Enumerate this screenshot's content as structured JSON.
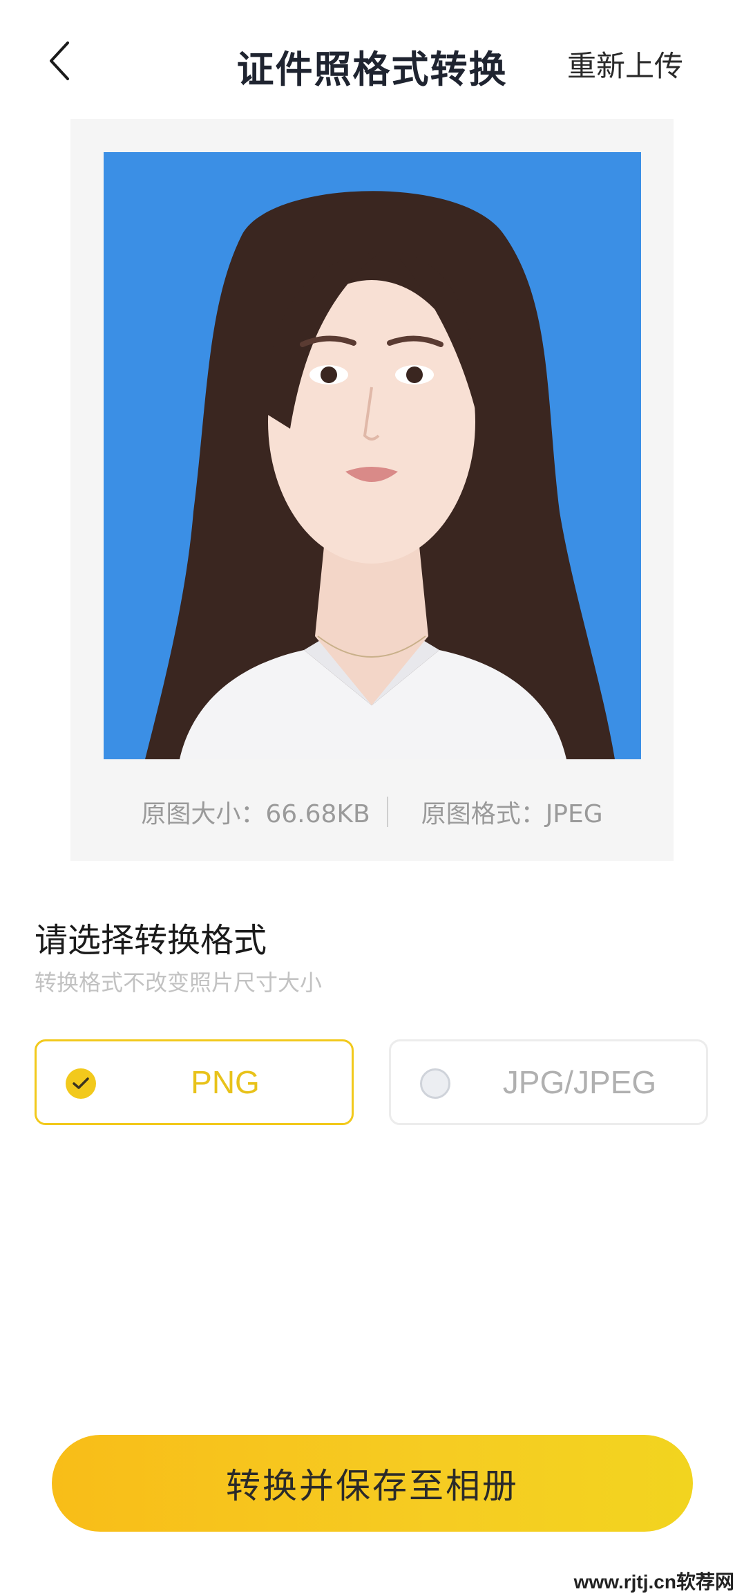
{
  "header": {
    "title": "证件照格式转换",
    "reupload_label": "重新上传",
    "back_icon": "chevron-left-icon"
  },
  "preview": {
    "background_color": "#3b8fe5",
    "size_text": "原图大小：66.68KB",
    "format_text": "原图格式：JPEG"
  },
  "format_section": {
    "title": "请选择转换格式",
    "subtitle": "转换格式不改变照片尺寸大小",
    "options": [
      {
        "label": "PNG",
        "selected": true
      },
      {
        "label": "JPG/JPEG",
        "selected": false
      }
    ],
    "accent_color": "#f2c91c"
  },
  "actions": {
    "primary_label": "转换并保存至相册"
  },
  "watermark": "www.rjtj.cn软荐网"
}
